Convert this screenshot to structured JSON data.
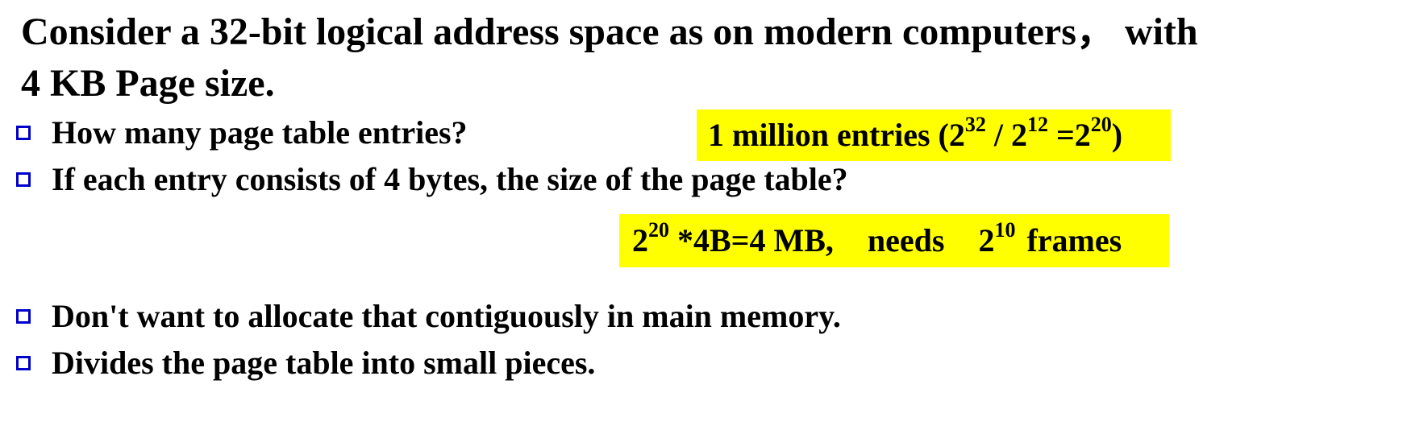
{
  "heading": {
    "line1": "Consider a 32-bit logical address space as on modern computers， with",
    "line2": "4 KB Page size."
  },
  "bullets": [
    {
      "text": "How many page table entries?"
    },
    {
      "text": "If each entry consists of 4 bytes, the size of the page table?"
    },
    {
      "text": "Don't want to allocate that contiguously in main memory."
    },
    {
      "text": "Divides the page table into small pieces."
    }
  ],
  "answer1": {
    "prefix": "1 million entries (2",
    "exp1": "32",
    "mid1": " / 2",
    "exp2": "12",
    "mid2": " =2",
    "exp3": "20",
    "suffix": ")"
  },
  "answer2": {
    "base1": "2",
    "exp1": "20",
    "text1": " *4B=4 MB,",
    "text2": "needs",
    "base2": "2",
    "exp2": "10",
    "text3": "frames"
  },
  "colors": {
    "bullet_marker": "#0000cc",
    "highlight": "#ffff00",
    "text": "#000000"
  }
}
